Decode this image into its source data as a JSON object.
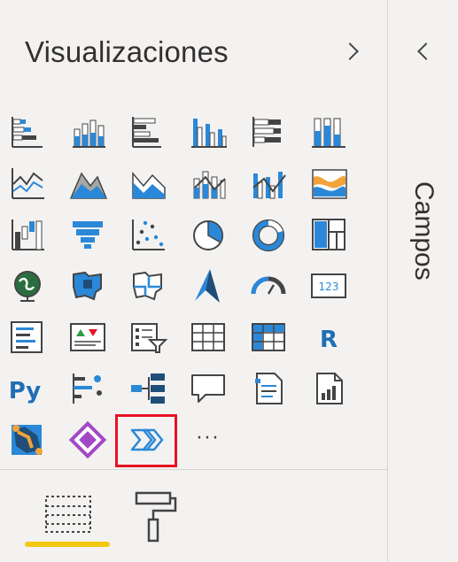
{
  "pane": {
    "title": "Visualizaciones",
    "expand_icon": "chevron-right-icon",
    "collapse_icon": "chevron-left-icon",
    "fields_label": "Campos"
  },
  "visuals": [
    "stacked-bar-chart-icon",
    "stacked-column-chart-icon",
    "clustered-bar-chart-icon",
    "clustered-column-chart-icon",
    "100-stacked-bar-chart-icon",
    "100-stacked-column-chart-icon",
    "line-chart-icon",
    "area-chart-icon",
    "stacked-area-chart-icon",
    "line-and-stacked-column-chart-icon",
    "line-and-clustered-column-chart-icon",
    "ribbon-chart-icon",
    "waterfall-chart-icon",
    "funnel-chart-icon",
    "scatter-chart-icon",
    "pie-chart-icon",
    "donut-chart-icon",
    "treemap-icon",
    "map-icon",
    "filled-map-icon",
    "shape-map-icon",
    "azure-map-icon",
    "gauge-icon",
    "card-icon",
    "multi-row-card-icon",
    "kpi-icon",
    "slicer-icon",
    "table-icon",
    "matrix-icon",
    "r-script-visual-icon",
    "python-visual-icon",
    "key-influencers-icon",
    "decomposition-tree-icon",
    "qa-icon",
    "smart-narrative-icon",
    "paginated-report-icon",
    "arcgis-map-icon",
    "power-apps-icon",
    "power-automate-icon",
    "more-visuals-icon"
  ],
  "selected_visual": "power-automate-icon",
  "glyphs": {
    "r": "R",
    "py": "Py",
    "card": "123",
    "more": "···"
  },
  "tabs": {
    "fields": "fields-icon",
    "format": "format-paint-roller-icon",
    "active": "fields"
  },
  "colors": {
    "accent": "#2b88d8",
    "dark_accent": "#1e4e79",
    "highlight": "#e81123",
    "active_tab": "#f2c811",
    "power_apps": "#a349c6"
  }
}
